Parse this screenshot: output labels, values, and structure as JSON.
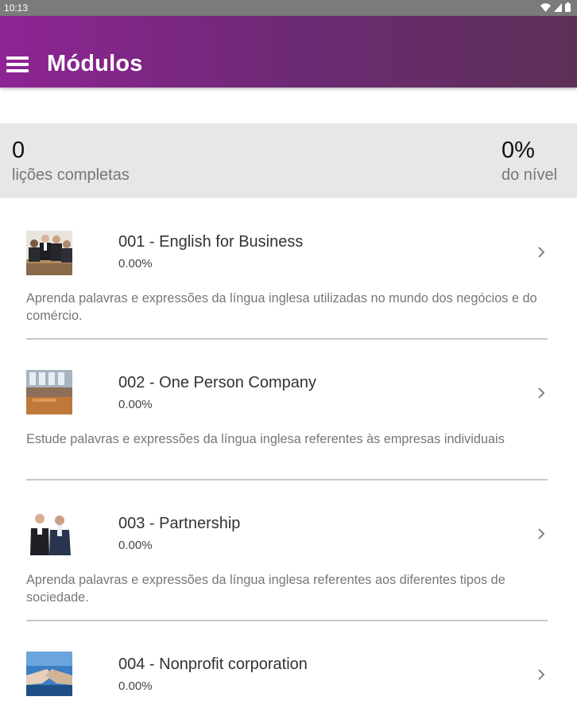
{
  "status_bar": {
    "time": "10:13",
    "icons": [
      "wifi-icon",
      "signal-icon",
      "battery-icon"
    ]
  },
  "app_bar": {
    "title": "Módulos",
    "menu_icon": "hamburger-menu-icon"
  },
  "stats": {
    "lessons_completed_value": "0",
    "lessons_completed_label": "lições completas",
    "level_value": "0%",
    "level_label": "do nível"
  },
  "modules": [
    {
      "title": "001 - English for Business",
      "progress": "0.00%",
      "description": "Aprenda palavras e expressões da língua inglesa utilizadas no mundo dos negócios e do comércio.",
      "thumbnail": "business-people-photo"
    },
    {
      "title": "002 - One Person Company",
      "progress": "0.00%",
      "description": "Estude palavras e expressões da língua inglesa referentes às empresas individuais",
      "thumbnail": "office-interior-photo"
    },
    {
      "title": "003 - Partnership",
      "progress": "0.00%",
      "description": "Aprenda palavras e expressões da língua inglesa referentes aos diferentes tipos de sociedade.",
      "thumbnail": "two-businessmen-photo"
    },
    {
      "title": "004 - Nonprofit corporation",
      "progress": "0.00%",
      "description": "",
      "thumbnail": "handshake-photo"
    }
  ],
  "colors": {
    "app_bar_start": "#8e2494",
    "app_bar_end": "#5e3058",
    "stats_background": "#e7e7e7",
    "status_bar": "#7b7b7b"
  }
}
